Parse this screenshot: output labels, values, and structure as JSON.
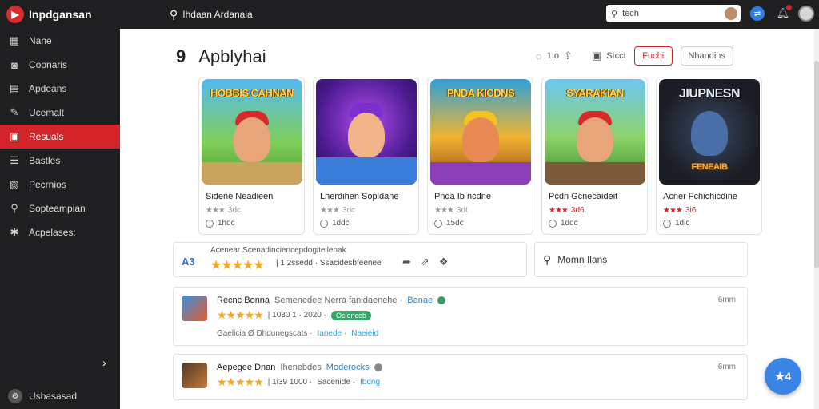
{
  "app": {
    "name": "Inpdgansan",
    "logo_icon": "play-icon",
    "brand_color": "#d3242a"
  },
  "topbar": {
    "title": "Ihdaan Ardanaia",
    "search_placeholder": "tech"
  },
  "sidebar": {
    "items": [
      {
        "label": "Nane",
        "icon": "grid-icon"
      },
      {
        "label": "Coonaris",
        "icon": "gamepad-icon"
      },
      {
        "label": "Apdeans",
        "icon": "chart-icon"
      },
      {
        "label": "Ucemalt",
        "icon": "brush-icon"
      },
      {
        "label": "Resuals",
        "icon": "store-icon",
        "active": true
      },
      {
        "label": "Bastles",
        "icon": "list-icon"
      },
      {
        "label": "Pecrnios",
        "icon": "doc-icon"
      },
      {
        "label": "Sopteampian",
        "icon": "search-icon"
      },
      {
        "label": "Acpelases:",
        "icon": "puzzle-icon"
      }
    ],
    "footer_label": "Usbasasad"
  },
  "page": {
    "number": "9",
    "title": "Apblyhai",
    "tools": {
      "count": "1Io",
      "select_label": "Stcct",
      "red_button": "Fuchi",
      "ghost_button": "Nhandins"
    }
  },
  "games": [
    {
      "title": "Sidene Neadieen",
      "banner": "HOBBIS CAHNAN",
      "rating_text": "3dc",
      "installs": "1hdc",
      "stars_red": false
    },
    {
      "title": "Lnerdihen Sopldane",
      "banner": "",
      "rating_text": "3dc",
      "installs": "1ddc",
      "stars_red": false
    },
    {
      "title": "Pnda Ib ncdne",
      "banner": "PNDA KICDNS",
      "rating_text": "3dt",
      "installs": "15dc",
      "stars_red": false
    },
    {
      "title": "Pcdn Gcnecaideit",
      "banner": "SYARAKIAN",
      "rating_text": "3d6",
      "installs": "1ddc",
      "stars_red": true
    },
    {
      "title": "Acner Fchichicdine",
      "banner": "JIUPNESN",
      "sub_banner": "FENEAIB",
      "rating_text": "3i6",
      "installs": "1dic",
      "stars_red": true
    }
  ],
  "summary": {
    "score": "A3",
    "top_text": "Acenear Scenadinciencepdogiteilenak",
    "stars": "★★★★★",
    "count_text": "| 1 2ssedd · Ssacidesbfeenee"
  },
  "review_search": {
    "label": "Momn Ilans"
  },
  "reviews": [
    {
      "name": "Recnc Bonna",
      "sub": "Semenedee Nerra fanidaenehe ·",
      "link": "Banae",
      "stars": "★★★★★",
      "count": "| 1030 1 · 2020 ·",
      "badge": "Ocienceb",
      "foot": "Gaelicia  Ø Dhdunegscats ·",
      "foot_link1": "Ianede ·",
      "foot_link2": "Naeieid",
      "time": "6mm"
    },
    {
      "name": "Aepegee Dnan",
      "sub": "Ihenebdes",
      "link": "Moderocks",
      "stars": "★★★★★",
      "count": "| 1i39 1000 ·",
      "badge": "",
      "foot": "Sacenide ·",
      "foot_link1": "Ibdng",
      "foot_link2": "",
      "time": "6mm"
    }
  ],
  "fab": {
    "label": "★4"
  }
}
